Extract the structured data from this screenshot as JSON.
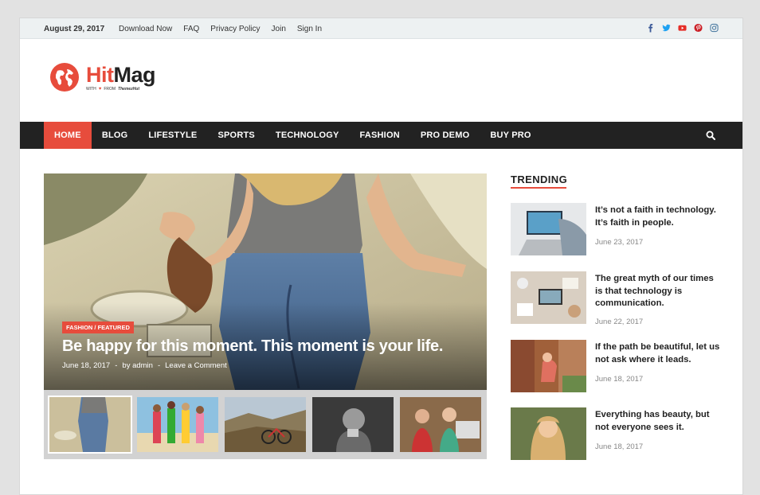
{
  "topbar": {
    "date": "August 29, 2017",
    "links": [
      "Download Now",
      "FAQ",
      "Privacy Policy",
      "Join",
      "Sign In"
    ],
    "social": [
      "facebook-icon",
      "twitter-icon",
      "youtube-icon",
      "pinterest-icon",
      "instagram-icon"
    ]
  },
  "logo": {
    "hit": "Hit",
    "mag": "Mag",
    "with": "WITH",
    "from": "FROM",
    "company": "ThemezHut"
  },
  "nav": {
    "items": [
      "HOME",
      "BLOG",
      "LIFESTYLE",
      "SPORTS",
      "TECHNOLOGY",
      "FASHION",
      "PRO DEMO",
      "BUY PRO"
    ],
    "active": "HOME"
  },
  "featured": {
    "category": "FASHION / FEATURED",
    "title": "Be happy for this moment. This moment is your life.",
    "date": "June 18, 2017",
    "author": "by admin",
    "comments": "Leave a Comment"
  },
  "trending": {
    "heading": "TRENDING",
    "posts": [
      {
        "title": "It’s not a faith in technology. It’s faith in people.",
        "date": "June 23, 2017"
      },
      {
        "title": "The great myth of our times is that technology is communication.",
        "date": "June 22, 2017"
      },
      {
        "title": "If the path be beautiful, let us not ask where it leads.",
        "date": "June 18, 2017"
      },
      {
        "title": "Everything has beauty, but not everyone sees it.",
        "date": "June 18, 2017"
      }
    ]
  },
  "colors": {
    "accent": "#e74c3c",
    "nav_bg": "#222222",
    "topbar_bg": "#edf1f2"
  }
}
